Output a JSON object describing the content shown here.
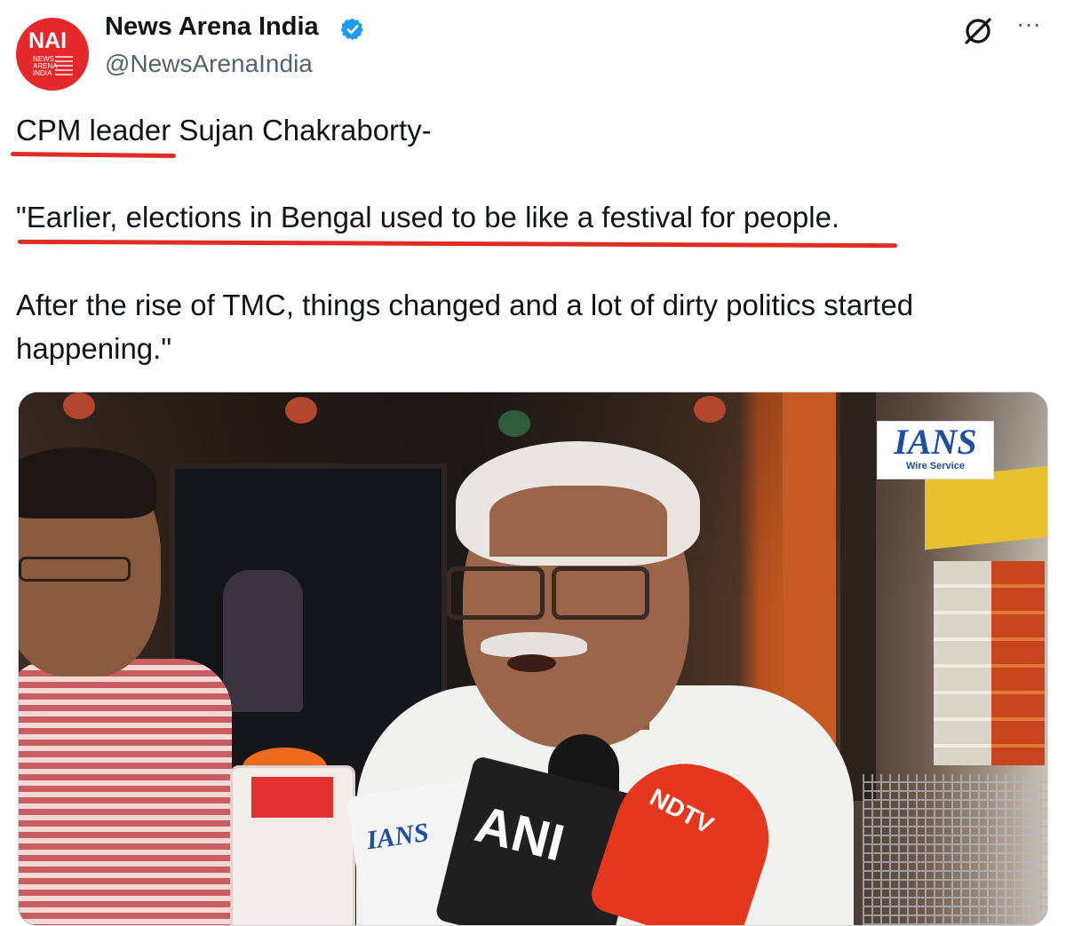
{
  "account": {
    "logo_text": "NAI",
    "logo_subtext": "NEWS ARENA INDIA",
    "display_name": "News Arena India",
    "handle": "@NewsArenaIndia"
  },
  "header_icons": {
    "grok": "grok-icon",
    "more": "more-icon",
    "more_glyph": "···"
  },
  "tweet": {
    "lines": [
      "CPM leader Sujan Chakraborty-",
      "\"Earlier, elections in Bengal used to be like a festival for people.",
      "After the rise of TMC, things changed and a lot of dirty politics started",
      "happening.\""
    ]
  },
  "media": {
    "watermark": "IANS",
    "watermark_sub": "Wire Service",
    "mic_labels": {
      "ians": "IANS",
      "ani": "ANI",
      "ndtv": "NDTV"
    }
  },
  "colors": {
    "underline": "#e02d24",
    "verified": "#1d9bf0",
    "text": "#0f1419",
    "secondary": "#536471"
  }
}
